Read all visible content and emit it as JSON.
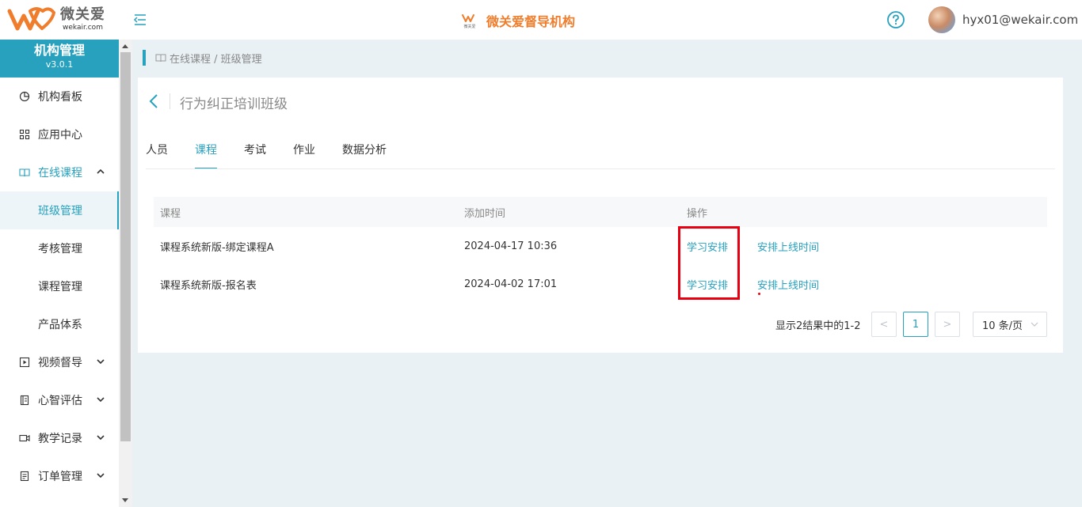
{
  "header": {
    "logo_cn": "微关爱",
    "logo_en": "wekair.com",
    "center_title": "微关爱督导机构",
    "mini_logo_text": "微关爱",
    "user_email": "hyx01@wekair.com"
  },
  "sidebar": {
    "title": "机构管理",
    "version": "v3.0.1",
    "items": [
      {
        "label": "机构看板",
        "icon": "pie-chart-icon"
      },
      {
        "label": "应用中心",
        "icon": "grid-icon"
      },
      {
        "label": "在线课程",
        "icon": "book-icon",
        "expanded": true
      },
      {
        "label": "班级管理",
        "sub": true,
        "active": true
      },
      {
        "label": "考核管理",
        "sub": true
      },
      {
        "label": "课程管理",
        "sub": true
      },
      {
        "label": "产品体系",
        "sub": true
      },
      {
        "label": "视频督导",
        "icon": "video-icon"
      },
      {
        "label": "心智评估",
        "icon": "notebook-icon"
      },
      {
        "label": "教学记录",
        "icon": "camera-icon"
      },
      {
        "label": "订单管理",
        "icon": "document-icon"
      }
    ]
  },
  "breadcrumb": "在线课程 / 班级管理",
  "page": {
    "title": "行为纠正培训班级",
    "tabs": [
      "人员",
      "课程",
      "考试",
      "作业",
      "数据分析"
    ],
    "active_tab": "课程"
  },
  "table": {
    "headers": [
      "课程",
      "添加时间",
      "操作"
    ],
    "rows": [
      {
        "course": "课程系统新版-绑定课程A",
        "time": "2024-04-17 10:36",
        "action1": "学习安排",
        "action2": "安排上线时间"
      },
      {
        "course": "课程系统新版-报名表",
        "time": "2024-04-02 17:01",
        "action1": "学习安排",
        "action2": "安排上线时间"
      }
    ]
  },
  "pagination": {
    "summary": "显示2结果中的1-2",
    "prev": "<",
    "current_page": "1",
    "next": ">",
    "page_size": "10 条/页"
  },
  "colors": {
    "accent": "#27a1be",
    "brand_orange": "#f07d2c",
    "highlight_red": "#e60012"
  }
}
